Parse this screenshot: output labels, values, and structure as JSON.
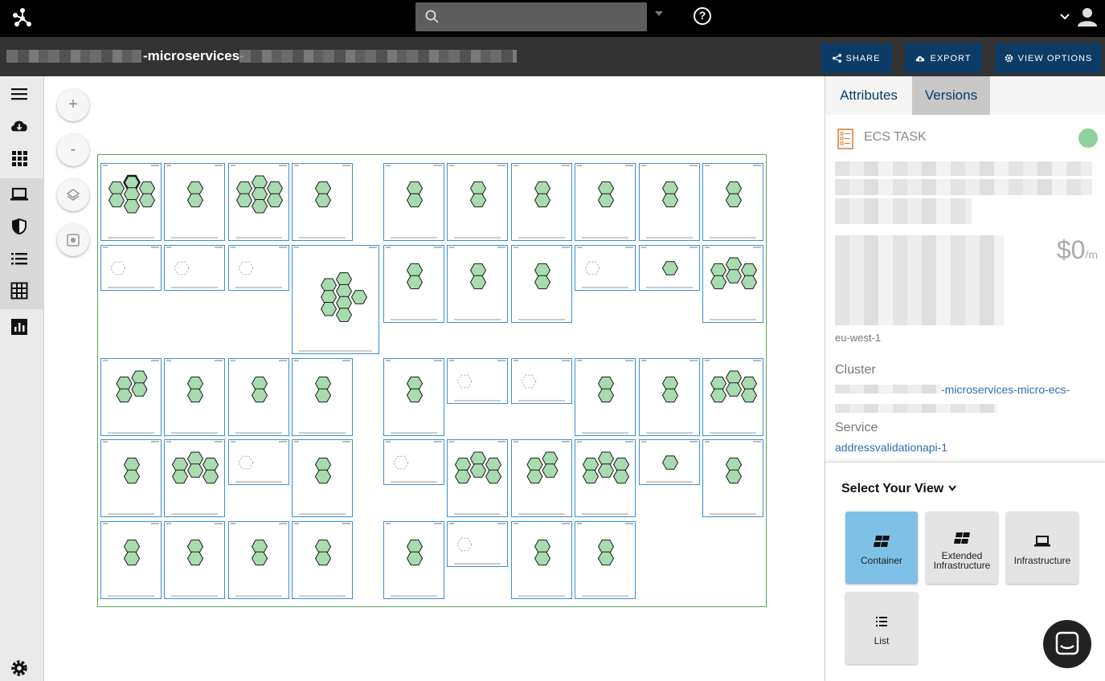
{
  "app": {
    "title_visible_fragment": "-microservices-",
    "search": {
      "placeholder": "",
      "value": ""
    }
  },
  "toolbar": {
    "share_label": "SHARE",
    "export_label": "EXPORT",
    "view_options_label": "VIEW OPTIONS"
  },
  "zoom_controls": {
    "zoom_in": "+",
    "zoom_out": "-"
  },
  "right_panel": {
    "tabs": [
      {
        "label": "Attributes",
        "active": false
      },
      {
        "label": "Versions",
        "active": true
      }
    ],
    "resource_type": "ECS TASK",
    "status_color": "#8fd19e",
    "cost": {
      "amount": "$0",
      "unit": "/m"
    },
    "region": "eu-west-1",
    "cluster_label": "Cluster",
    "cluster_value_fragment": "-microservices-micro-ecs-",
    "service_label": "Service",
    "service_value": "addressvalidationapi-1",
    "select_view_label": "Select Your View",
    "views": [
      {
        "label": "Container",
        "active": true,
        "icon": "container-icon"
      },
      {
        "label": "Extended Infrastructure",
        "active": false,
        "icon": "extended-infrastructure-icon"
      },
      {
        "label": "Infrastructure",
        "active": false,
        "icon": "infrastructure-icon"
      },
      {
        "label": "List",
        "active": false,
        "icon": "list-icon"
      }
    ]
  },
  "colors": {
    "topbar": "#000000",
    "titlebar": "#333333",
    "button_bg": "#0c3b66",
    "cluster_border": "#5aa05a",
    "task_border": "#3a8fd4",
    "hex_fill": "#a8dbb0",
    "active_view": "#7ec0e6",
    "link": "#2e6fb4"
  },
  "sidebar_icons": [
    "menu-icon",
    "cloud-download-icon",
    "apps-grid-icon",
    "laptop-icon",
    "shield-icon",
    "list-icon",
    "table-grid-icon",
    "bar-chart-icon",
    "settings-icon"
  ]
}
